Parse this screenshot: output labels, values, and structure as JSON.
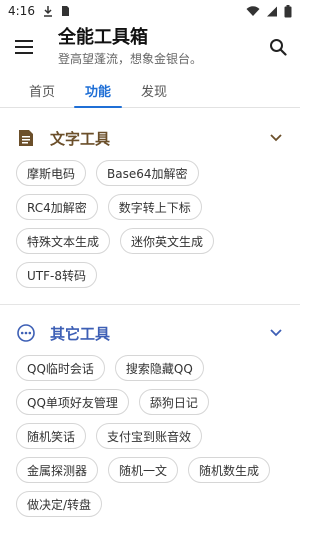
{
  "status_bar": {
    "time": "4:16"
  },
  "app_bar": {
    "title": "全能工具箱",
    "subtitle": "登高望蓬流，想象金银台。"
  },
  "tabs": [
    {
      "label": "首页",
      "active": false
    },
    {
      "label": "功能",
      "active": true
    },
    {
      "label": "发现",
      "active": false
    }
  ],
  "sections": {
    "text_tools": {
      "title": "文字工具",
      "items": [
        "摩斯电码",
        "Base64加解密",
        "RC4加解密",
        "数字转上下标",
        "特殊文本生成",
        "迷你英文生成",
        "UTF-8转码"
      ]
    },
    "other_tools": {
      "title": "其它工具",
      "items": [
        "QQ临时会话",
        "搜索隐藏QQ",
        "QQ单项好友管理",
        "舔狗日记",
        "随机笑话",
        "支付宝到账音效",
        "金属探测器",
        "随机一文",
        "随机数生成",
        "做决定/转盘"
      ]
    }
  },
  "colors": {
    "accent": "#1f6fd6",
    "text_tools_title": "#6b4f2a",
    "other_tools_title": "#3d5fb5"
  }
}
